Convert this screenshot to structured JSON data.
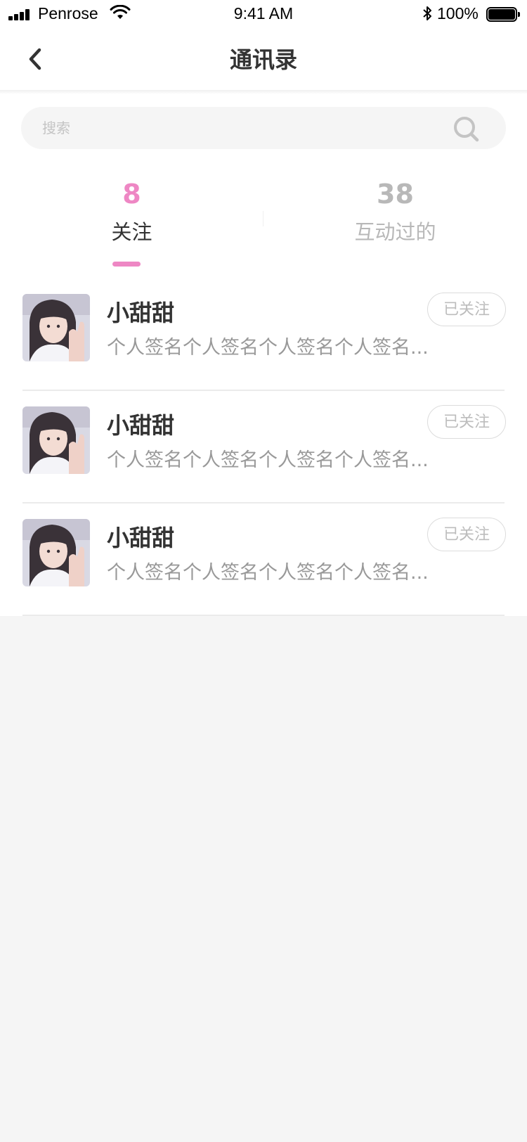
{
  "status_bar": {
    "carrier": "Penrose",
    "time": "9:41 AM",
    "battery": "100%"
  },
  "nav": {
    "title": "通讯录",
    "back_icon": "chevron-left-icon"
  },
  "search": {
    "placeholder": "搜索",
    "value": "",
    "icon": "search-icon"
  },
  "tabs": [
    {
      "count": "8",
      "label": "关注",
      "active": true
    },
    {
      "count": "38",
      "label": "互动过的",
      "active": false
    }
  ],
  "contacts": [
    {
      "name": "小甜甜",
      "signature": "个人签名个人签名个人签名个人签名...",
      "button": "已关注"
    },
    {
      "name": "小甜甜",
      "signature": "个人签名个人签名个人签名个人签名...",
      "button": "已关注"
    },
    {
      "name": "小甜甜",
      "signature": "个人签名个人签名个人签名个人签名...",
      "button": "已关注"
    }
  ],
  "colors": {
    "accent": "#ee87c4",
    "inactive": "#b8b8b8",
    "background": "#f5f5f5"
  }
}
